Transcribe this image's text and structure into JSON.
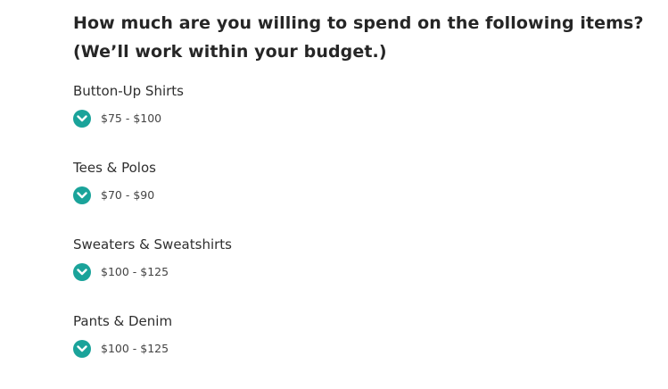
{
  "question": "How much are you willing to spend on the following items? (We’ll work within your budget.)",
  "items": [
    {
      "title": "Button-Up Shirts",
      "answer": "$75 - $100"
    },
    {
      "title": "Tees & Polos",
      "answer": "$70 - $90"
    },
    {
      "title": "Sweaters & Sweatshirts",
      "answer": "$100 - $125"
    },
    {
      "title": "Pants & Denim",
      "answer": "$100 - $125"
    }
  ],
  "colors": {
    "check_bg": "#1aa39a",
    "check_mark": "#ffffff"
  },
  "icons": {
    "answer_marker": "check-circle-icon"
  }
}
